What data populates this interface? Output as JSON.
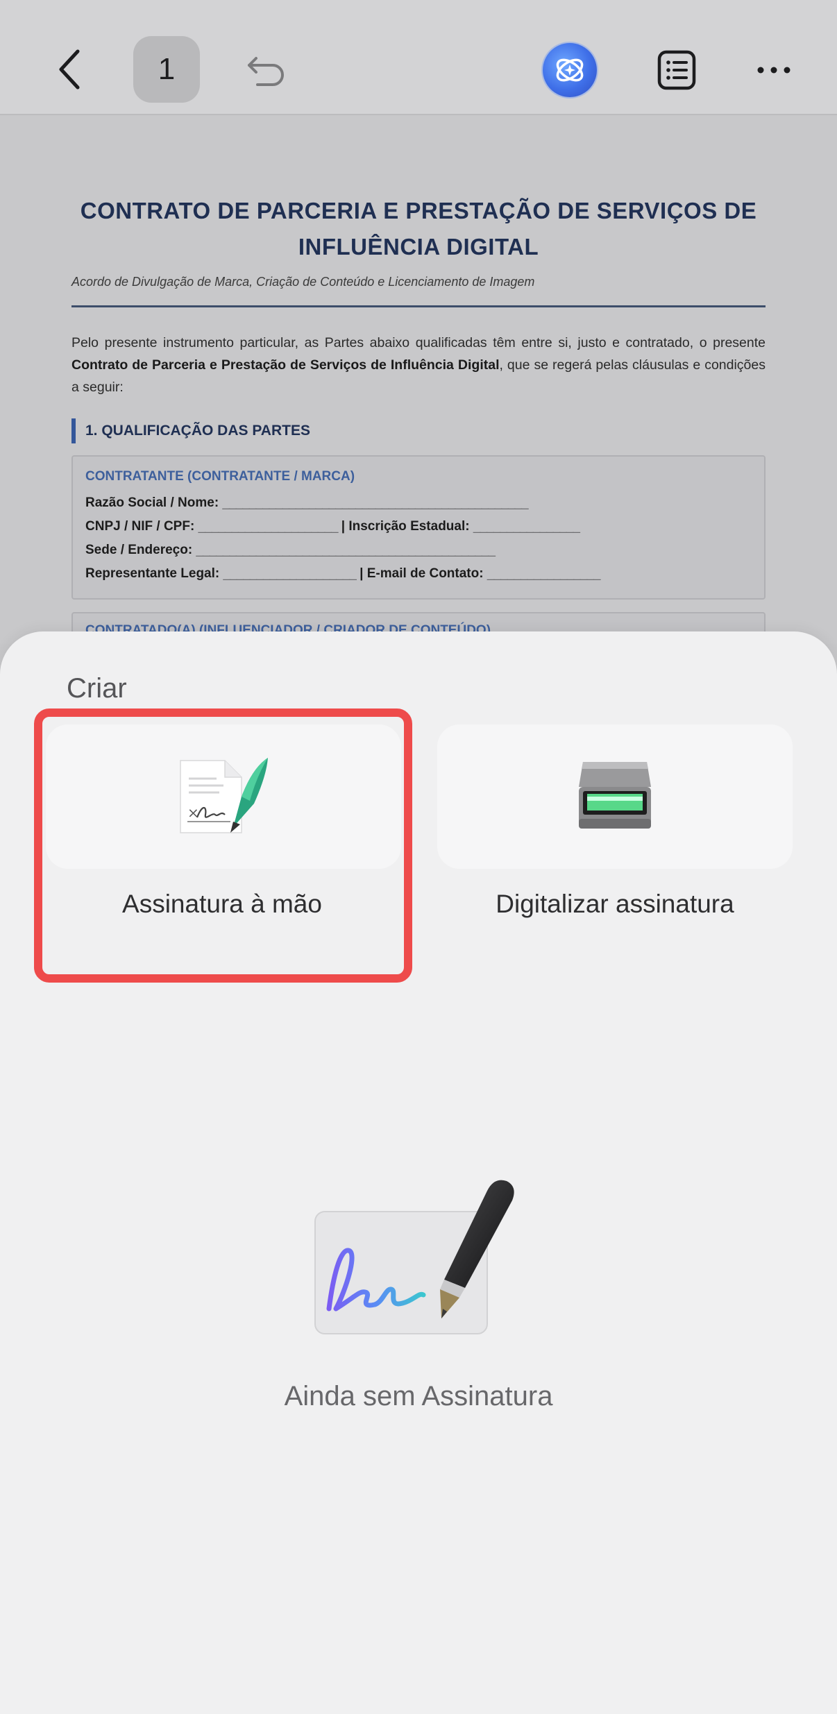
{
  "toolbar": {
    "page_number": "1",
    "back_icon": "chevron-left-icon",
    "undo_icon": "undo-icon",
    "ai_icon": "ai-assistant-icon",
    "list_icon": "list-icon",
    "more_icon": "more-icon"
  },
  "document": {
    "title": "CONTRATO DE PARCERIA E PRESTAÇÃO DE SERVIÇOS DE INFLUÊNCIA DIGITAL",
    "subtitle": "Acordo de Divulgação de Marca, Criação de Conteúdo e Licenciamento de Imagem",
    "intro_part1": "Pelo presente instrumento particular, as Partes abaixo qualificadas têm entre si, justo e contratado, o presente ",
    "intro_bold": "Contrato de Parceria e Prestação de Serviços de Influência Digital",
    "intro_part2": ", que se regerá pelas cláusulas e condições a seguir:",
    "section_1": "1. QUALIFICAÇÃO DAS PARTES",
    "contratante": {
      "heading": "CONTRATANTE (CONTRATANTE / MARCA)",
      "razao_label": "Razão Social / Nome:",
      "cnpj_label": "CNPJ / NIF / CPF:",
      "ie_label": "| Inscrição Estadual:",
      "sede_label": "Sede / Endereço:",
      "rep_label": "Representante Legal:",
      "email_label": "| E-mail de Contato:"
    },
    "contratado_heading": "CONTRATADO(A) (INFLUENCIADOR / CRIADOR DE CONTEÚDO)"
  },
  "sheet": {
    "section_label": "Criar",
    "options": [
      {
        "label": "Assinatura à mão",
        "icon": "handwritten-signature-icon"
      },
      {
        "label": "Digitalizar assinatura",
        "icon": "scanner-icon"
      }
    ],
    "empty_text": "Ainda sem Assinatura",
    "empty_icon": "signature-pen-illustration"
  },
  "colors": {
    "highlight": "#ee4b4b",
    "accent_blue": "#34579a",
    "title_navy": "#1f2f52"
  }
}
